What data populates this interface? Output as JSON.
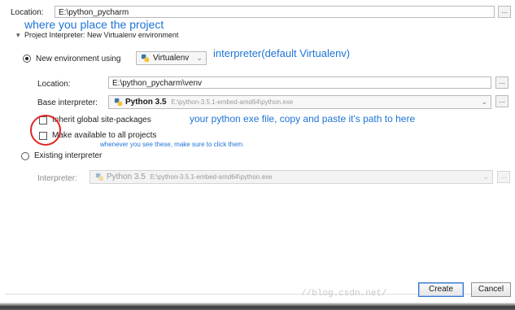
{
  "top": {
    "location_label": "Location:",
    "location_value": "E:\\python_pycharm",
    "browse_label": "..."
  },
  "annotations": {
    "location_note": "where you place the project",
    "interpreter_note": "interpreter(default Virtualenv)",
    "exe_note": "your python exe file, copy and paste it's path to here",
    "checkbox_note": "whenever you see these, make sure to click them"
  },
  "section": {
    "title": "Project Interpreter: New Virtualenv environment",
    "toggle_glyph": "▾"
  },
  "new_env": {
    "radio_label": "New environment using",
    "tool_select": "Virtualenv",
    "location_label": "Location:",
    "location_value": "E:\\python_pycharm\\venv",
    "base_label": "Base interpreter:",
    "base_version": "Python 3.5",
    "base_path": "E:\\python-3.5.1-embed-amd64\\python.exe",
    "inherit_label": "Inherit global site-packages",
    "available_label": "Make available to all projects"
  },
  "existing": {
    "radio_label": "Existing interpreter",
    "interpreter_label": "Interpreter:",
    "version": "Python 3.5",
    "path": "E:\\python-3.5.1-embed-amd64\\python.exe"
  },
  "buttons": {
    "create": "Create",
    "cancel": "Cancel"
  },
  "watermark": "//blog.csdn.net/",
  "colors": {
    "annotation_blue": "#1e73d6",
    "highlight_red": "#e32424"
  },
  "icons": {
    "python": "python-icon",
    "dropdown": "chevron-down-icon"
  }
}
